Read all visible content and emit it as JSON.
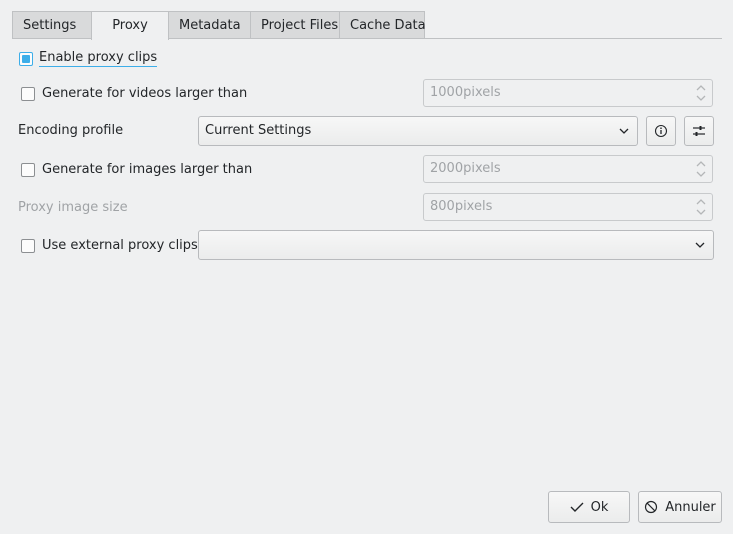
{
  "tabs": [
    {
      "label": "Settings"
    },
    {
      "label": "Proxy"
    },
    {
      "label": "Metadata"
    },
    {
      "label": "Project Files"
    },
    {
      "label": "Cache Data"
    }
  ],
  "active_tab": "Proxy",
  "proxy": {
    "enable_proxy": {
      "label": "Enable proxy clips",
      "checked": true
    },
    "gen_videos": {
      "label": "Generate for videos larger than",
      "checked": false,
      "value": "1000pixels"
    },
    "encoding_profile": {
      "label": "Encoding profile",
      "value": "Current Settings"
    },
    "gen_images": {
      "label": "Generate for images larger than",
      "checked": false,
      "value": "2000pixels"
    },
    "proxy_image_size": {
      "label": "Proxy image size",
      "value": "800pixels"
    },
    "external_proxy": {
      "label": "Use external proxy clips",
      "checked": false,
      "value": ""
    }
  },
  "buttons": {
    "ok": "Ok",
    "cancel": "Annuler"
  },
  "colors": {
    "accent": "#3daee9",
    "background": "#eff0f1"
  },
  "icons": {
    "info": "info-icon",
    "configure": "sliders-icon",
    "ok": "checkmark-icon",
    "cancel": "cancel-icon"
  }
}
